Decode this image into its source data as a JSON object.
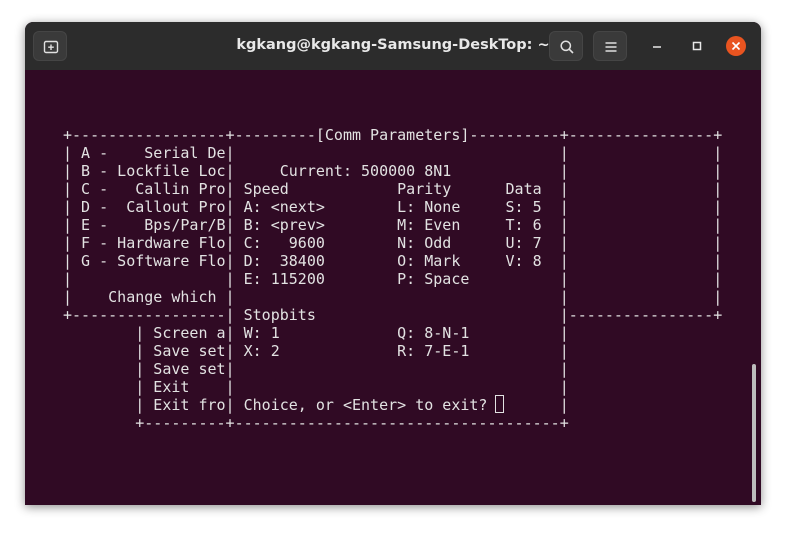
{
  "window": {
    "title": "kgkang@kgkang-Samsung-DeskTop: ~",
    "icons": {
      "new_tab": "new-tab-icon",
      "search": "search-icon",
      "menu": "hamburger-menu-icon",
      "minimize": "minimize-icon",
      "maximize": "maximize-icon",
      "close": "close-icon"
    },
    "accent_close": "#e95420",
    "terminal_bg": "#300a24"
  },
  "terminal": {
    "lines": [
      "+-----------------+---------[Comm Parameters]----------+----------------+",
      "| A -    Serial De|                                    |                |",
      "| B - Lockfile Loc|     Current: 500000 8N1            |                |",
      "| C -   Callin Pro| Speed            Parity      Data  |                |",
      "| D -  Callout Pro| A: <next>        L: None     S: 5  |                |",
      "| E -    Bps/Par/B| B: <prev>        M: Even     T: 6  |                |",
      "| F - Hardware Flo| C:   9600        N: Odd      U: 7  |                |",
      "| G - Software Flo| D:  38400        O: Mark     V: 8  |                |",
      "|                 | E: 115200        P: Space          |                |",
      "|    Change which |                                    |                |",
      "+-----------------| Stopbits                           |----------------+",
      "        | Screen a| W: 1             Q: 8-N-1          |",
      "        | Save set| X: 2             R: 7-E-1          |",
      "        | Save set|                                    |",
      "        | Exit    |                                    |",
      "        | Exit fro| Choice, or <Enter> to exit?        |",
      "        +---------+------------------------------------+"
    ]
  }
}
